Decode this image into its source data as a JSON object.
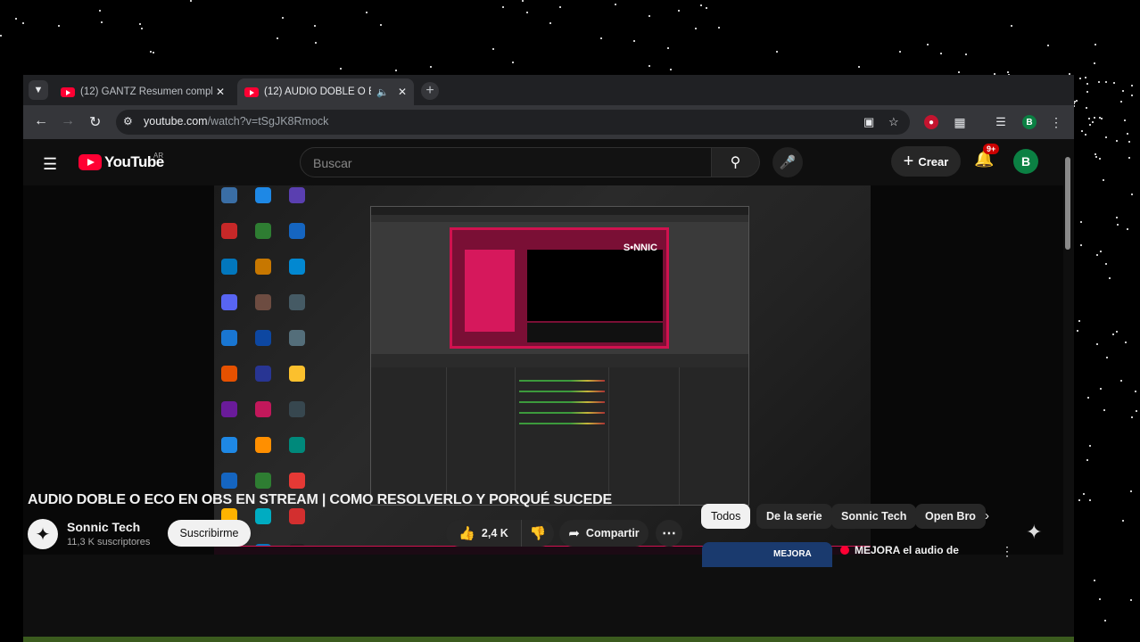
{
  "browser": {
    "tabs": [
      {
        "title": "(12) GANTZ Resumen completo",
        "active": false
      },
      {
        "title": "(12) AUDIO DOBLE O ECO E",
        "active": true
      }
    ],
    "url_host": "youtube.com",
    "url_path": "/watch?v=tSgJK8Rmock",
    "profile_initial": "B"
  },
  "youtube": {
    "logo_text": "YouTube",
    "country": "AR",
    "search_placeholder": "Buscar",
    "create_label": "Crear",
    "notif_count": "9+",
    "avatar_initial": "B"
  },
  "video": {
    "title": "AUDIO DOBLE O ECO EN OBS EN STREAM | COMO RESOLVERLO Y PORQUÉ SUCEDE",
    "channel": "Sonnic Tech",
    "subscribers": "11,3 K suscriptores",
    "subscribe_label": "Suscribirme",
    "likes": "2,4 K",
    "share_label": "Compartir",
    "frame_logo": "S•NNIC"
  },
  "chips": [
    "Todos",
    "De la serie",
    "Sonnic Tech",
    "Open Bro"
  ],
  "recommendation": {
    "thumb_text": "MEJORA",
    "title": "MEJORA el audio de"
  },
  "colors": {
    "youtube_red": "#ff0033",
    "scene_pink": "#d0124f",
    "avatar_green": "#0b8043"
  }
}
